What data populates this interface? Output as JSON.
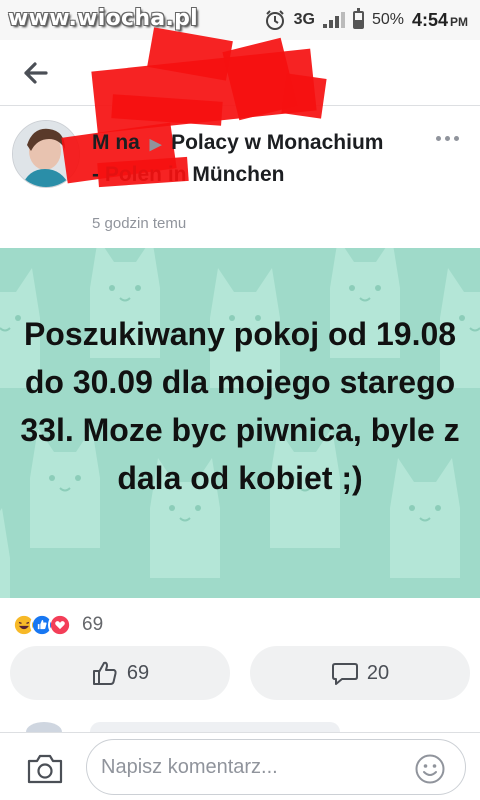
{
  "status_bar": {
    "watermark": "www.wiocha.pl",
    "network": "3G",
    "battery": "50%",
    "time": "4:54",
    "ampm": "PM"
  },
  "post": {
    "author": "M    na",
    "group": "Polacy w Monachium - Polen in München",
    "time": "5 godzin temu"
  },
  "card": {
    "background": "#9fdac9",
    "text": "Poszukiwany pokoj od 19.08 do 30.09 dla mojego starego 33l. Moze byc piwnica, byle z dala od kobiet ;)"
  },
  "reactions": {
    "icons": [
      "haha-icon",
      "like-icon",
      "love-icon"
    ],
    "count": "69"
  },
  "actions": {
    "like_count": "69",
    "comment_count": "20"
  },
  "comment": {
    "placeholder": "Napisz komentarz..."
  },
  "colors": {
    "like_blue": "#1877f2",
    "love_red": "#f33e58",
    "haha_yellow": "#f7b928",
    "redaction": "#f51010"
  }
}
